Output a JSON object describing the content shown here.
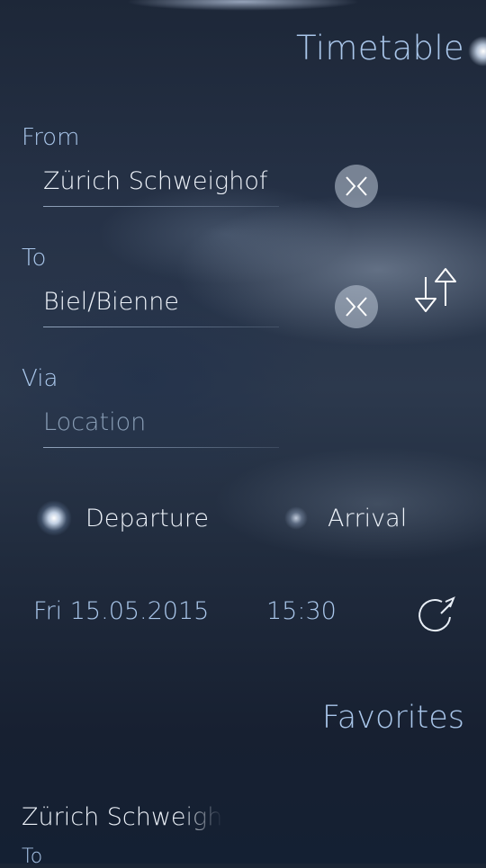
{
  "header": {
    "title": "Timetable"
  },
  "from": {
    "label": "From",
    "value": "Zürich Schweighof",
    "placeholder": "Location"
  },
  "to": {
    "label": "To",
    "value": "Biel/Bienne",
    "placeholder": "Location"
  },
  "via": {
    "label": "Via",
    "value": "",
    "placeholder": "Location"
  },
  "mode": {
    "options": [
      "Departure",
      "Arrival"
    ],
    "selected": "Departure"
  },
  "datetime": {
    "date": "Fri 15.05.2015",
    "time": "15:30"
  },
  "favorites": {
    "title": "Favorites",
    "items": [
      {
        "from": "Zürich Schweighof",
        "to_label": "To"
      }
    ]
  },
  "colors": {
    "highlight": "#a9c6ea",
    "primary_text": "#eef3fa",
    "background": "#1b2535"
  },
  "icons": [
    "clear-icon",
    "swap-icon",
    "reset-time-icon",
    "pulley-menu-indicator"
  ]
}
